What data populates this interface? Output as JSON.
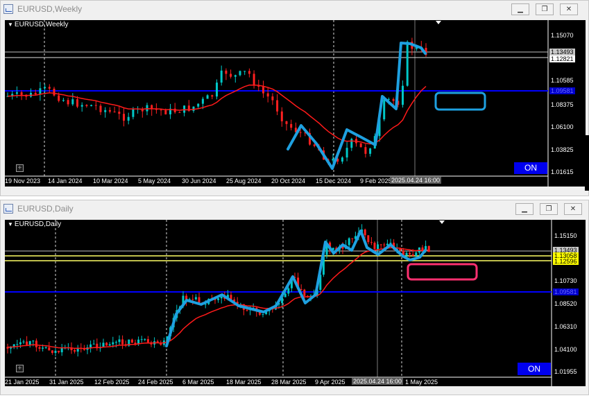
{
  "weekly": {
    "title": "EURUSD,Weekly",
    "label": "EURUSD,Weekly",
    "buttons": {
      "minimize": "▁",
      "restore": "❐",
      "close": "✕"
    },
    "on_button": "ON",
    "x_labels": [
      "19 Nov 2023",
      "14 Jan 2024",
      "10 Mar 2024",
      "5 May 2024",
      "30 Jun 2024",
      "25 Aug 2024",
      "20 Oct 2024",
      "15 Dec 2024",
      "9 Feb 2025"
    ],
    "date_highlight": "2025.04.24 16:00",
    "price_ticks": [
      "1.15070",
      "1.10585",
      "1.08375",
      "1.06100",
      "1.03825",
      "1.01615"
    ],
    "price_tags": {
      "ask": "1.13493",
      "bid": "1.12821",
      "level": "1.09581"
    },
    "colors": {
      "background": "#000000",
      "ma": "#ff1a1a",
      "level_line": "#0000ff",
      "drawing": "#1ea0e0",
      "box": "#1ea0e0",
      "on_button": "#0000ee"
    }
  },
  "daily": {
    "title": "EURUSD,Daily",
    "label": "EURUSD,Daily",
    "buttons": {
      "minimize": "▁",
      "restore": "❐",
      "close": "✕"
    },
    "on_button": "ON",
    "x_labels": [
      "21 Jan 2025",
      "31 Jan 2025",
      "12 Feb 2025",
      "24 Feb 2025",
      "6 Mar 2025",
      "18 Mar 2025",
      "28 Mar 2025",
      "9 Apr 2025",
      "1 May 2025"
    ],
    "date_highlight": "2025.04.24 16:00",
    "price_ticks": [
      "1.15150",
      "1.10730",
      "1.08520",
      "1.06310",
      "1.04100",
      "1.01955"
    ],
    "price_tags": {
      "ask": "1.13493",
      "yellow1": "1.13058",
      "yellow2": "1.12596",
      "level": "1.09581"
    },
    "colors": {
      "background": "#000000",
      "ma": "#ff1a1a",
      "level_line": "#0000ff",
      "support_lines": "#ffff66",
      "drawing": "#1ea0e0",
      "box": "#ff3070",
      "on_button": "#0000ee"
    }
  }
}
